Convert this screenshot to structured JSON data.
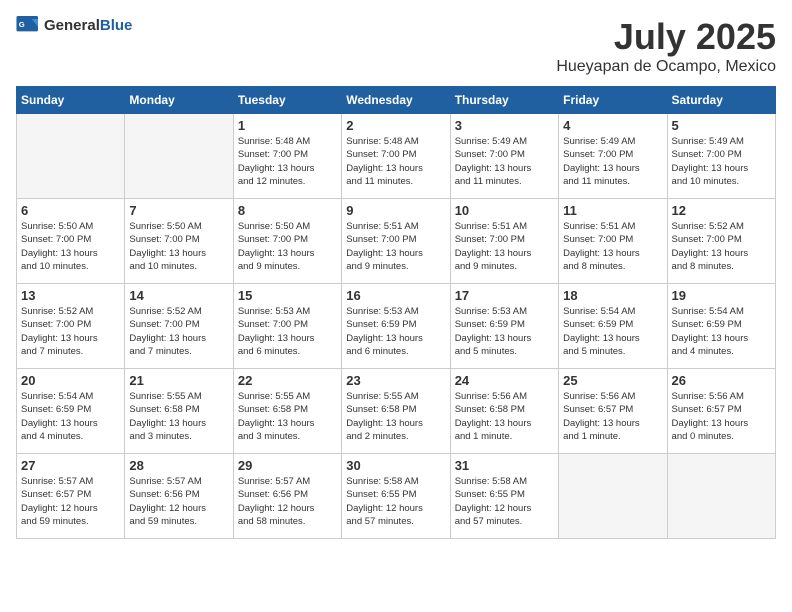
{
  "logo": {
    "general": "General",
    "blue": "Blue"
  },
  "header": {
    "month": "July 2025",
    "location": "Hueyapan de Ocampo, Mexico"
  },
  "weekdays": [
    "Sunday",
    "Monday",
    "Tuesday",
    "Wednesday",
    "Thursday",
    "Friday",
    "Saturday"
  ],
  "weeks": [
    [
      {
        "day": "",
        "info": ""
      },
      {
        "day": "",
        "info": ""
      },
      {
        "day": "1",
        "info": "Sunrise: 5:48 AM\nSunset: 7:00 PM\nDaylight: 13 hours\nand 12 minutes."
      },
      {
        "day": "2",
        "info": "Sunrise: 5:48 AM\nSunset: 7:00 PM\nDaylight: 13 hours\nand 11 minutes."
      },
      {
        "day": "3",
        "info": "Sunrise: 5:49 AM\nSunset: 7:00 PM\nDaylight: 13 hours\nand 11 minutes."
      },
      {
        "day": "4",
        "info": "Sunrise: 5:49 AM\nSunset: 7:00 PM\nDaylight: 13 hours\nand 11 minutes."
      },
      {
        "day": "5",
        "info": "Sunrise: 5:49 AM\nSunset: 7:00 PM\nDaylight: 13 hours\nand 10 minutes."
      }
    ],
    [
      {
        "day": "6",
        "info": "Sunrise: 5:50 AM\nSunset: 7:00 PM\nDaylight: 13 hours\nand 10 minutes."
      },
      {
        "day": "7",
        "info": "Sunrise: 5:50 AM\nSunset: 7:00 PM\nDaylight: 13 hours\nand 10 minutes."
      },
      {
        "day": "8",
        "info": "Sunrise: 5:50 AM\nSunset: 7:00 PM\nDaylight: 13 hours\nand 9 minutes."
      },
      {
        "day": "9",
        "info": "Sunrise: 5:51 AM\nSunset: 7:00 PM\nDaylight: 13 hours\nand 9 minutes."
      },
      {
        "day": "10",
        "info": "Sunrise: 5:51 AM\nSunset: 7:00 PM\nDaylight: 13 hours\nand 9 minutes."
      },
      {
        "day": "11",
        "info": "Sunrise: 5:51 AM\nSunset: 7:00 PM\nDaylight: 13 hours\nand 8 minutes."
      },
      {
        "day": "12",
        "info": "Sunrise: 5:52 AM\nSunset: 7:00 PM\nDaylight: 13 hours\nand 8 minutes."
      }
    ],
    [
      {
        "day": "13",
        "info": "Sunrise: 5:52 AM\nSunset: 7:00 PM\nDaylight: 13 hours\nand 7 minutes."
      },
      {
        "day": "14",
        "info": "Sunrise: 5:52 AM\nSunset: 7:00 PM\nDaylight: 13 hours\nand 7 minutes."
      },
      {
        "day": "15",
        "info": "Sunrise: 5:53 AM\nSunset: 7:00 PM\nDaylight: 13 hours\nand 6 minutes."
      },
      {
        "day": "16",
        "info": "Sunrise: 5:53 AM\nSunset: 6:59 PM\nDaylight: 13 hours\nand 6 minutes."
      },
      {
        "day": "17",
        "info": "Sunrise: 5:53 AM\nSunset: 6:59 PM\nDaylight: 13 hours\nand 5 minutes."
      },
      {
        "day": "18",
        "info": "Sunrise: 5:54 AM\nSunset: 6:59 PM\nDaylight: 13 hours\nand 5 minutes."
      },
      {
        "day": "19",
        "info": "Sunrise: 5:54 AM\nSunset: 6:59 PM\nDaylight: 13 hours\nand 4 minutes."
      }
    ],
    [
      {
        "day": "20",
        "info": "Sunrise: 5:54 AM\nSunset: 6:59 PM\nDaylight: 13 hours\nand 4 minutes."
      },
      {
        "day": "21",
        "info": "Sunrise: 5:55 AM\nSunset: 6:58 PM\nDaylight: 13 hours\nand 3 minutes."
      },
      {
        "day": "22",
        "info": "Sunrise: 5:55 AM\nSunset: 6:58 PM\nDaylight: 13 hours\nand 3 minutes."
      },
      {
        "day": "23",
        "info": "Sunrise: 5:55 AM\nSunset: 6:58 PM\nDaylight: 13 hours\nand 2 minutes."
      },
      {
        "day": "24",
        "info": "Sunrise: 5:56 AM\nSunset: 6:58 PM\nDaylight: 13 hours\nand 1 minute."
      },
      {
        "day": "25",
        "info": "Sunrise: 5:56 AM\nSunset: 6:57 PM\nDaylight: 13 hours\nand 1 minute."
      },
      {
        "day": "26",
        "info": "Sunrise: 5:56 AM\nSunset: 6:57 PM\nDaylight: 13 hours\nand 0 minutes."
      }
    ],
    [
      {
        "day": "27",
        "info": "Sunrise: 5:57 AM\nSunset: 6:57 PM\nDaylight: 12 hours\nand 59 minutes."
      },
      {
        "day": "28",
        "info": "Sunrise: 5:57 AM\nSunset: 6:56 PM\nDaylight: 12 hours\nand 59 minutes."
      },
      {
        "day": "29",
        "info": "Sunrise: 5:57 AM\nSunset: 6:56 PM\nDaylight: 12 hours\nand 58 minutes."
      },
      {
        "day": "30",
        "info": "Sunrise: 5:58 AM\nSunset: 6:55 PM\nDaylight: 12 hours\nand 57 minutes."
      },
      {
        "day": "31",
        "info": "Sunrise: 5:58 AM\nSunset: 6:55 PM\nDaylight: 12 hours\nand 57 minutes."
      },
      {
        "day": "",
        "info": ""
      },
      {
        "day": "",
        "info": ""
      }
    ]
  ]
}
